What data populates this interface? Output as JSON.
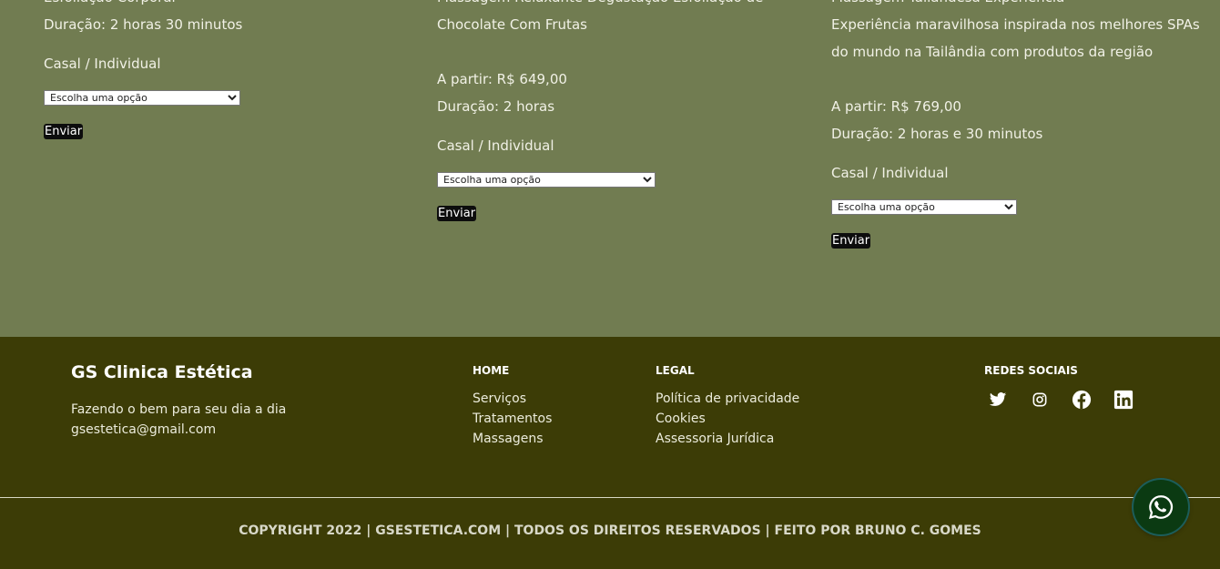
{
  "products": [
    {
      "clipped_text": "Esfoliação Corporal",
      "lines": [
        "Duração: 2 horas 30 minutos"
      ],
      "price": "",
      "duration": "",
      "type_label": "Casal / Individual",
      "select_value": "Escolha uma opção",
      "button": "Enviar"
    },
    {
      "clipped_text": "Massagem Relaxante Degustação Esfoliação de",
      "lines": [
        "Chocolate Com Frutas"
      ],
      "price": "A partir: R$ 649,00",
      "duration": "Duração: 2 horas",
      "type_label": "Casal / Individual",
      "select_value": "Escolha uma opção",
      "button": "Enviar"
    },
    {
      "clipped_text": "Massagem Tailandesa Experiência",
      "lines": [
        "Experiência maravilhosa inspirada nos melhores SPAs",
        "do mundo na Tailândia com produtos da região"
      ],
      "price": "A partir: R$ 769,00",
      "duration": "Duração: 2 horas e 30 minutos",
      "type_label": "Casal / Individual",
      "select_value": "Escolha uma opção",
      "button": "Enviar"
    }
  ],
  "footer": {
    "brand": "GS Clinica Estética",
    "tagline": "Fazendo o bem para seu dia a dia",
    "email": "gsestetica@gmail.com",
    "home": {
      "heading": "HOME",
      "links": [
        "Serviços",
        "Tratamentos",
        "Massagens"
      ]
    },
    "legal": {
      "heading": "LEGAL",
      "links": [
        "Política de privacidade",
        "Cookies",
        "Assessoria Jurídica"
      ]
    },
    "social": {
      "heading": "REDES SOCIAIS",
      "icons": [
        "twitter-icon",
        "instagram-icon",
        "facebook-icon",
        "linkedin-icon"
      ]
    },
    "copyright": "COPYRIGHT 2022 | GSESTETICA.COM | TODOS OS DIREITOS RESERVADOS | FEITO POR BRUNO C. GOMES"
  },
  "whatsapp": {
    "icon": "whatsapp-icon"
  },
  "colors": {
    "products_bg": "#717c51",
    "footer_bg": "#3c3c06",
    "button_bg": "#0d0d0d",
    "whatsapp_bg": "#0b3a12"
  }
}
